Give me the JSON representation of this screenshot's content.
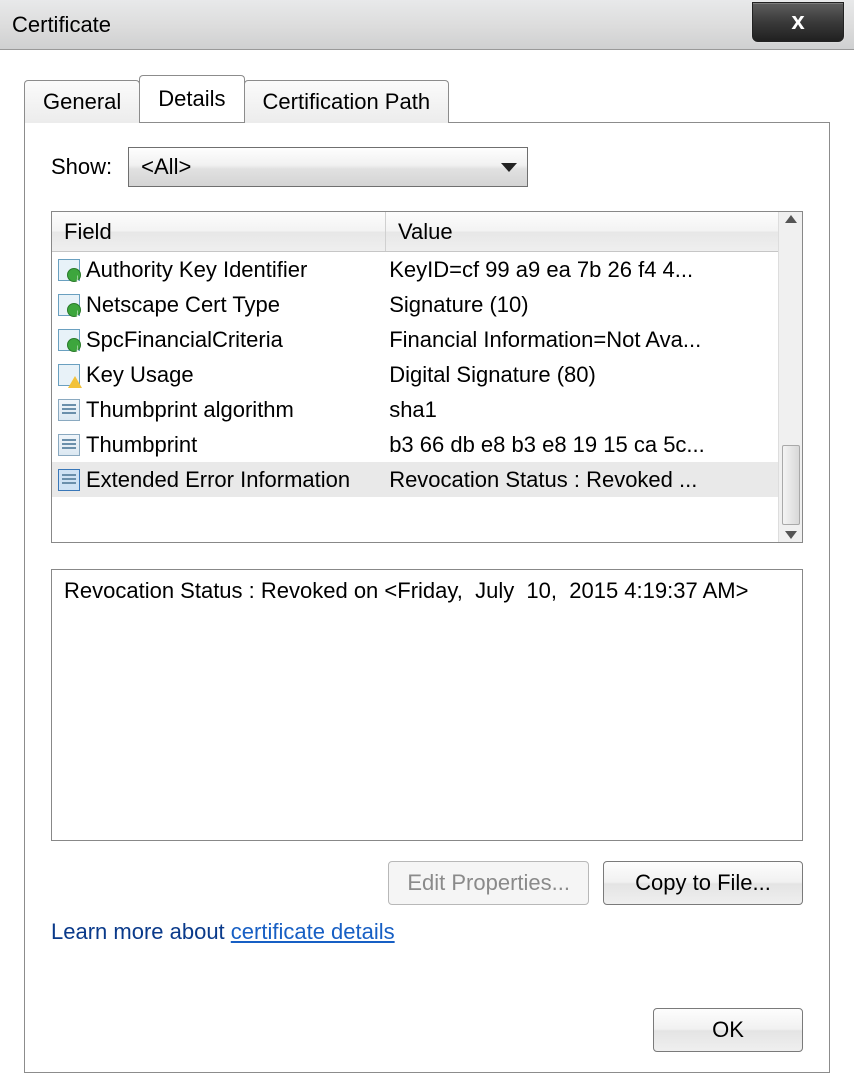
{
  "window": {
    "title": "Certificate"
  },
  "tabs": {
    "general": "General",
    "details": "Details",
    "certpath": "Certification Path",
    "active": "details"
  },
  "show": {
    "label": "Show:",
    "value": "<All>"
  },
  "columns": {
    "field": "Field",
    "value": "Value"
  },
  "rows": [
    {
      "icon": "ext-green",
      "field": "Authority Key Identifier",
      "value": "KeyID=cf 99 a9 ea 7b 26 f4 4..."
    },
    {
      "icon": "ext-green",
      "field": "Netscape Cert Type",
      "value": "Signature (10)"
    },
    {
      "icon": "ext-green",
      "field": "SpcFinancialCriteria",
      "value": "Financial Information=Not Ava..."
    },
    {
      "icon": "ext-warn",
      "field": "Key Usage",
      "value": "Digital Signature (80)"
    },
    {
      "icon": "prop",
      "field": "Thumbprint algorithm",
      "value": "sha1"
    },
    {
      "icon": "prop",
      "field": "Thumbprint",
      "value": "b3 66 db e8 b3 e8 19 15 ca 5c..."
    },
    {
      "icon": "prop-sel",
      "field": "Extended Error Information",
      "value": "Revocation Status : Revoked ...",
      "selected": true
    }
  ],
  "detail_text": "Revocation Status : Revoked on <​Friday,  July  10,  2015 4:19:37 AM​>",
  "buttons": {
    "edit_properties": "Edit Properties...",
    "copy_to_file": "Copy to File...",
    "ok": "OK"
  },
  "learn": {
    "prefix": "Learn more about ",
    "link": "certificate details"
  }
}
